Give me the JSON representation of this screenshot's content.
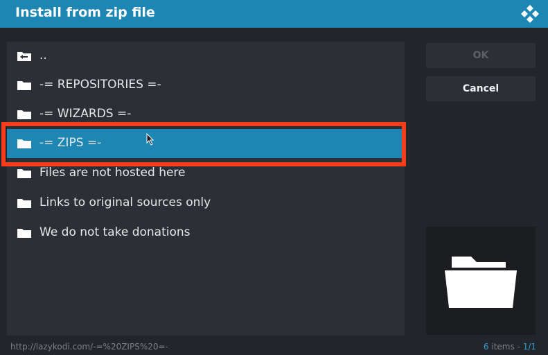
{
  "dialog": {
    "title": "Install from zip file",
    "logo_icon": "kodi-logo-icon"
  },
  "list": {
    "items": [
      {
        "label": "..",
        "icon": "parent-folder-icon",
        "selected": false
      },
      {
        "label": "-= REPOSITORIES  =-",
        "icon": "folder-icon",
        "selected": false
      },
      {
        "label": "-= WIZARDS =-",
        "icon": "folder-icon",
        "selected": false
      },
      {
        "label": "-= ZIPS =-",
        "icon": "folder-icon",
        "selected": true
      },
      {
        "label": "Files are not hosted here",
        "icon": "folder-icon",
        "selected": false
      },
      {
        "label": "Links to original sources only",
        "icon": "folder-icon",
        "selected": false
      },
      {
        "label": "We do not take donations",
        "icon": "folder-icon",
        "selected": false
      }
    ]
  },
  "buttons": {
    "ok_label": "OK",
    "cancel_label": "Cancel"
  },
  "preview": {
    "icon": "large-folder-icon"
  },
  "footer": {
    "path": "http://lazykodi.com/-=%20ZIPS%20=-",
    "count": "6",
    "count_suffix": " items - ",
    "page": "1/1"
  },
  "colors": {
    "title_bar": "#1e86b3",
    "selection": "#1e86b3",
    "annotation_box": "#f33d1b",
    "background": "#22252a",
    "panel": "#2c2f35"
  }
}
